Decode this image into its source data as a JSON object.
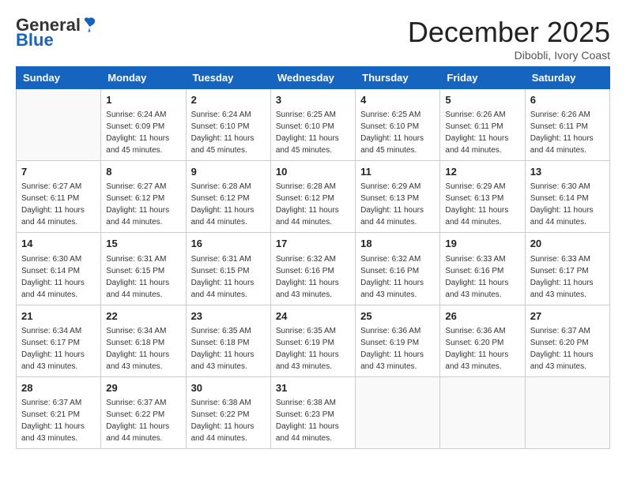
{
  "logo": {
    "general": "General",
    "blue": "Blue"
  },
  "title": "December 2025",
  "location": "Dibobli, Ivory Coast",
  "days_of_week": [
    "Sunday",
    "Monday",
    "Tuesday",
    "Wednesday",
    "Thursday",
    "Friday",
    "Saturday"
  ],
  "weeks": [
    [
      {
        "day": "",
        "info": ""
      },
      {
        "day": "1",
        "info": "Sunrise: 6:24 AM\nSunset: 6:09 PM\nDaylight: 11 hours and 45 minutes."
      },
      {
        "day": "2",
        "info": "Sunrise: 6:24 AM\nSunset: 6:10 PM\nDaylight: 11 hours and 45 minutes."
      },
      {
        "day": "3",
        "info": "Sunrise: 6:25 AM\nSunset: 6:10 PM\nDaylight: 11 hours and 45 minutes."
      },
      {
        "day": "4",
        "info": "Sunrise: 6:25 AM\nSunset: 6:10 PM\nDaylight: 11 hours and 45 minutes."
      },
      {
        "day": "5",
        "info": "Sunrise: 6:26 AM\nSunset: 6:11 PM\nDaylight: 11 hours and 44 minutes."
      },
      {
        "day": "6",
        "info": "Sunrise: 6:26 AM\nSunset: 6:11 PM\nDaylight: 11 hours and 44 minutes."
      }
    ],
    [
      {
        "day": "7",
        "info": "Sunrise: 6:27 AM\nSunset: 6:11 PM\nDaylight: 11 hours and 44 minutes."
      },
      {
        "day": "8",
        "info": "Sunrise: 6:27 AM\nSunset: 6:12 PM\nDaylight: 11 hours and 44 minutes."
      },
      {
        "day": "9",
        "info": "Sunrise: 6:28 AM\nSunset: 6:12 PM\nDaylight: 11 hours and 44 minutes."
      },
      {
        "day": "10",
        "info": "Sunrise: 6:28 AM\nSunset: 6:12 PM\nDaylight: 11 hours and 44 minutes."
      },
      {
        "day": "11",
        "info": "Sunrise: 6:29 AM\nSunset: 6:13 PM\nDaylight: 11 hours and 44 minutes."
      },
      {
        "day": "12",
        "info": "Sunrise: 6:29 AM\nSunset: 6:13 PM\nDaylight: 11 hours and 44 minutes."
      },
      {
        "day": "13",
        "info": "Sunrise: 6:30 AM\nSunset: 6:14 PM\nDaylight: 11 hours and 44 minutes."
      }
    ],
    [
      {
        "day": "14",
        "info": "Sunrise: 6:30 AM\nSunset: 6:14 PM\nDaylight: 11 hours and 44 minutes."
      },
      {
        "day": "15",
        "info": "Sunrise: 6:31 AM\nSunset: 6:15 PM\nDaylight: 11 hours and 44 minutes."
      },
      {
        "day": "16",
        "info": "Sunrise: 6:31 AM\nSunset: 6:15 PM\nDaylight: 11 hours and 44 minutes."
      },
      {
        "day": "17",
        "info": "Sunrise: 6:32 AM\nSunset: 6:16 PM\nDaylight: 11 hours and 43 minutes."
      },
      {
        "day": "18",
        "info": "Sunrise: 6:32 AM\nSunset: 6:16 PM\nDaylight: 11 hours and 43 minutes."
      },
      {
        "day": "19",
        "info": "Sunrise: 6:33 AM\nSunset: 6:16 PM\nDaylight: 11 hours and 43 minutes."
      },
      {
        "day": "20",
        "info": "Sunrise: 6:33 AM\nSunset: 6:17 PM\nDaylight: 11 hours and 43 minutes."
      }
    ],
    [
      {
        "day": "21",
        "info": "Sunrise: 6:34 AM\nSunset: 6:17 PM\nDaylight: 11 hours and 43 minutes."
      },
      {
        "day": "22",
        "info": "Sunrise: 6:34 AM\nSunset: 6:18 PM\nDaylight: 11 hours and 43 minutes."
      },
      {
        "day": "23",
        "info": "Sunrise: 6:35 AM\nSunset: 6:18 PM\nDaylight: 11 hours and 43 minutes."
      },
      {
        "day": "24",
        "info": "Sunrise: 6:35 AM\nSunset: 6:19 PM\nDaylight: 11 hours and 43 minutes."
      },
      {
        "day": "25",
        "info": "Sunrise: 6:36 AM\nSunset: 6:19 PM\nDaylight: 11 hours and 43 minutes."
      },
      {
        "day": "26",
        "info": "Sunrise: 6:36 AM\nSunset: 6:20 PM\nDaylight: 11 hours and 43 minutes."
      },
      {
        "day": "27",
        "info": "Sunrise: 6:37 AM\nSunset: 6:20 PM\nDaylight: 11 hours and 43 minutes."
      }
    ],
    [
      {
        "day": "28",
        "info": "Sunrise: 6:37 AM\nSunset: 6:21 PM\nDaylight: 11 hours and 43 minutes."
      },
      {
        "day": "29",
        "info": "Sunrise: 6:37 AM\nSunset: 6:22 PM\nDaylight: 11 hours and 44 minutes."
      },
      {
        "day": "30",
        "info": "Sunrise: 6:38 AM\nSunset: 6:22 PM\nDaylight: 11 hours and 44 minutes."
      },
      {
        "day": "31",
        "info": "Sunrise: 6:38 AM\nSunset: 6:23 PM\nDaylight: 11 hours and 44 minutes."
      },
      {
        "day": "",
        "info": ""
      },
      {
        "day": "",
        "info": ""
      },
      {
        "day": "",
        "info": ""
      }
    ]
  ]
}
